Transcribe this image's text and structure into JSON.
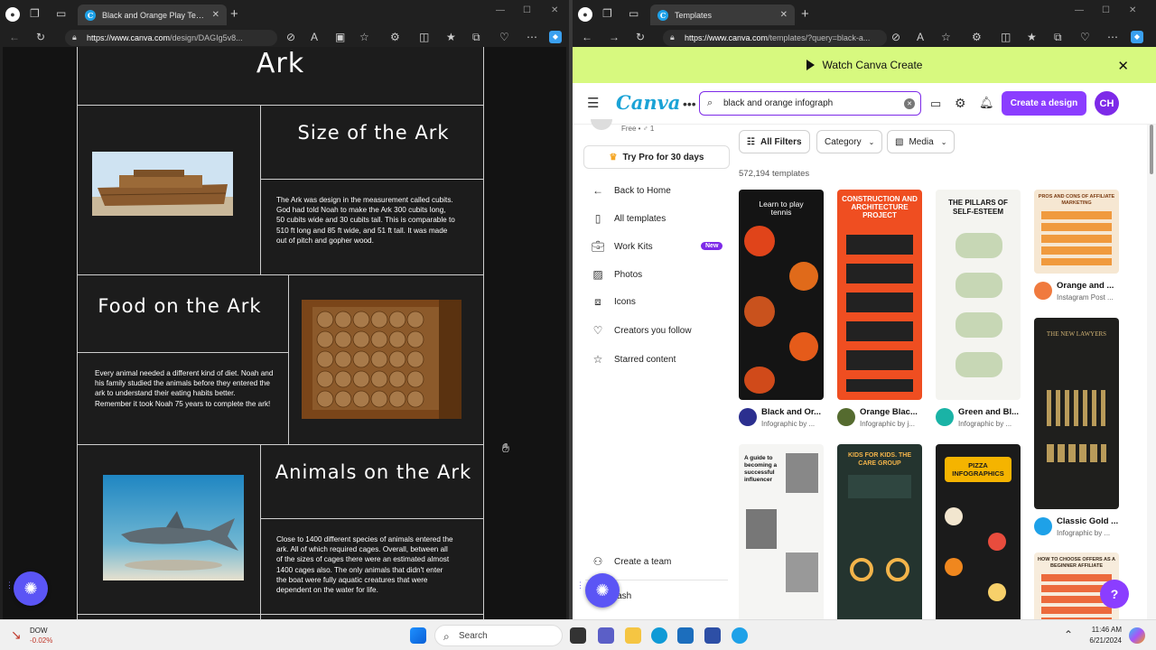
{
  "left_window": {
    "tab_title": "Black and Orange Play Tennis Mo",
    "url_host": "https://www.canva.com",
    "url_path": "/design/DAGIg5v8...",
    "doc": {
      "title_top": "Ark",
      "s1_title": "Size of the Ark",
      "s1_text": "The Ark was design in the measurement called cubits.  God had told Noah to make the Ark 300 cubits long, 50 cubits wide and 30 cubits tall. This is comparable to 510 ft long and 85 ft wide, and 51 ft tall. It was made out of pitch and gopher wood.",
      "s2_title": "Food on the Ark",
      "s2_text": "Every animal needed a different kind of diet. Noah and his family studied the animals before they entered the ark to understand  their eating habits better. Remember it took Noah 75 years to complete the ark!",
      "s3_title": "Animals on the Ark",
      "s3_text": "Close to 1400 different species of animals entered the ark. All of which required cages. Overall, between all of the sizes of cages there were an estimated almost 1400 cages also. The only animals that didn't enter the boat were fully aquatic creatures that were dependent on the water for life."
    }
  },
  "right_window": {
    "tab_title": "Templates",
    "url_host": "https://www.canva.com",
    "url_path": "/templates/?query=black-a...",
    "banner": "Watch Canva Create",
    "logo": "Canva",
    "search_value": "black and orange infograph",
    "create_button": "Create a design",
    "avatar_initials": "CH",
    "plan_line": "Free • ♂ 1",
    "try_pro": "Try Pro for 30 days",
    "sidebar": [
      {
        "label": "Back to Home",
        "icon": "arrow-left-icon"
      },
      {
        "label": "All templates",
        "icon": "templates-icon"
      },
      {
        "label": "Work Kits",
        "icon": "briefcase-icon",
        "badge": "New"
      },
      {
        "label": "Photos",
        "icon": "photo-icon"
      },
      {
        "label": "Icons",
        "icon": "shapes-icon"
      },
      {
        "label": "Creators you follow",
        "icon": "heart-icon"
      },
      {
        "label": "Starred content",
        "icon": "star-icon"
      }
    ],
    "sidebar_bottom": [
      "Create a team",
      "Trash"
    ],
    "filters": [
      "All Filters",
      "Category",
      "Media"
    ],
    "result_count": "572,194 templates",
    "cards": [
      {
        "title": "Black and Or...",
        "sub": "Infographic by ..."
      },
      {
        "title": "Orange Blac...",
        "sub": "Infographic by j..."
      },
      {
        "title": "Green and Bl...",
        "sub": "Infographic by ..."
      },
      {
        "title": "Orange and ...",
        "sub": "Instagram Post ..."
      },
      {
        "title": "Classic Gold ...",
        "sub": "Infographic by ..."
      }
    ],
    "card_text": {
      "c1": "Learn to play tennis",
      "c2": "CONSTRUCTION AND ARCHITECTURE PROJECT",
      "c3": "THE PILLARS OF SELF-ESTEEM",
      "c4": "PROS AND CONS OF AFFILIATE MARKETING",
      "c5": "THE NEW LAWYERS",
      "c6": "A guide to becoming a successful influencer",
      "c7": "KIDS FOR KIDS. THE CARE GROUP",
      "c8": "PIZZA INFOGRAPHICS",
      "c9": "HOW TO CHOOSE OFFERS AS A BEGINNER AFFILIATE"
    }
  },
  "taskbar": {
    "stock_name": "DOW",
    "stock_change": "-0.02%",
    "search": "Search",
    "time": "11:46 AM",
    "date": "6/21/2024"
  }
}
